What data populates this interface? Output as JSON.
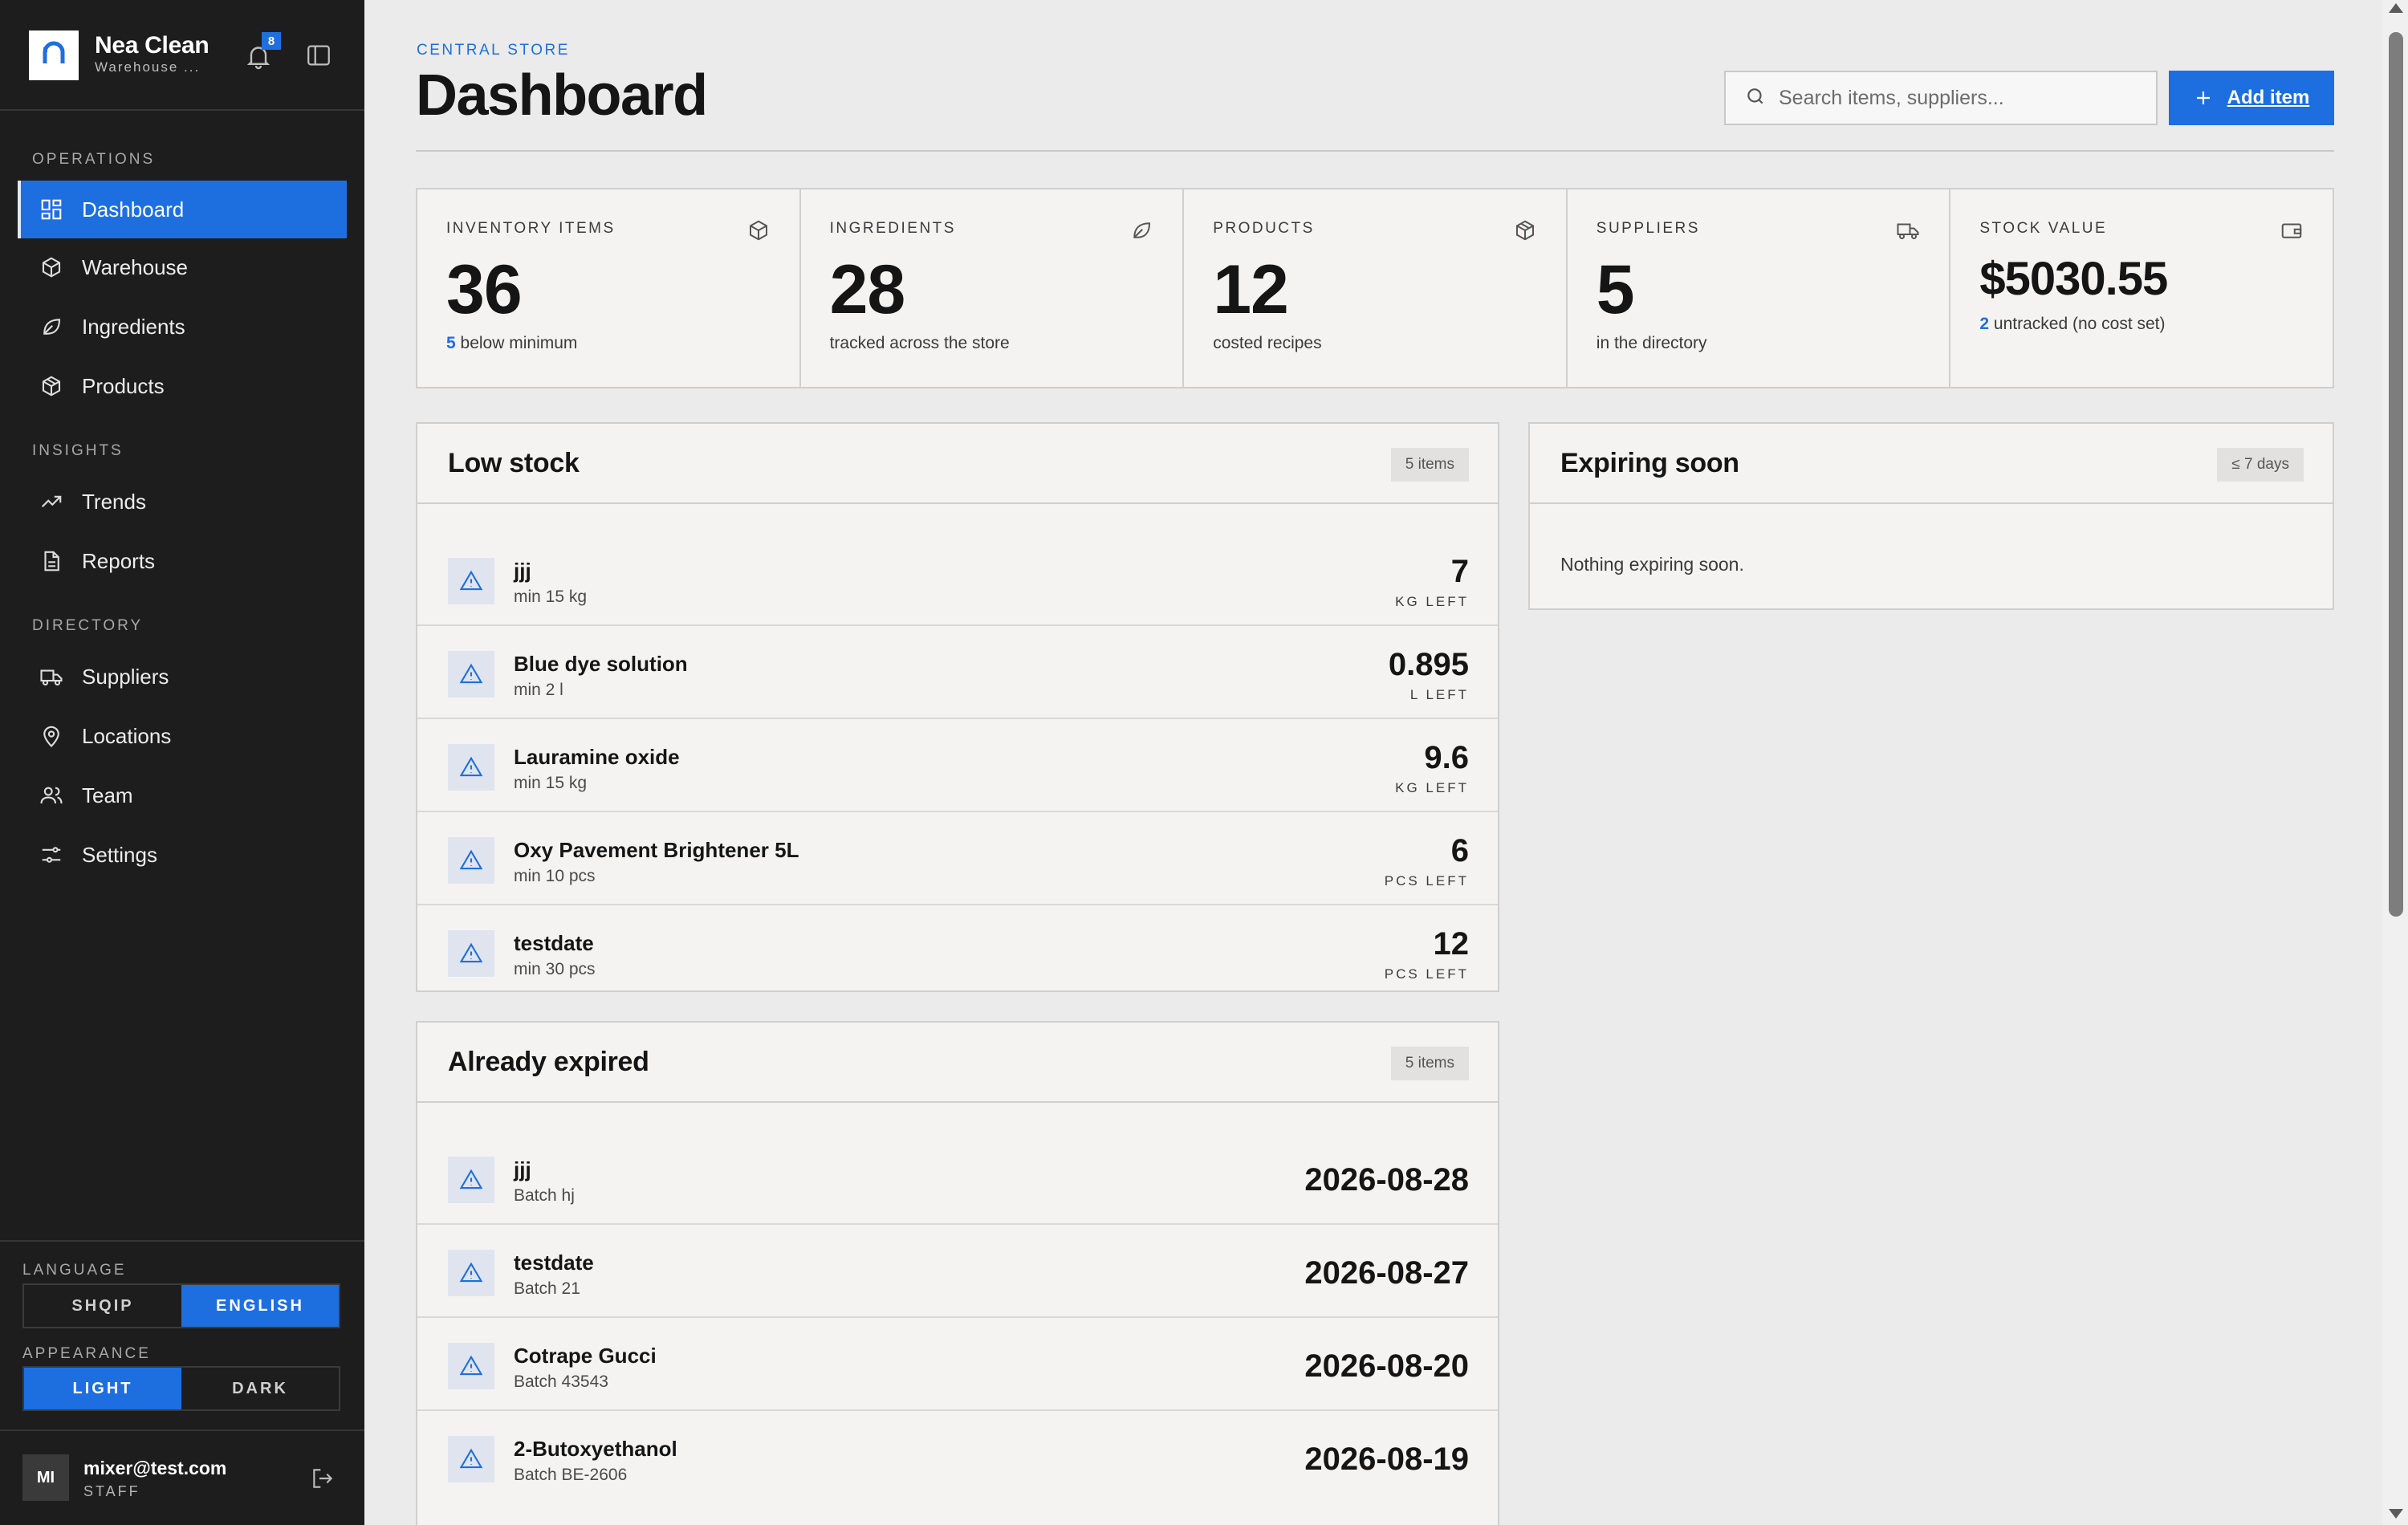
{
  "brand": {
    "name": "Nea Clean",
    "subtitle": "Warehouse ...",
    "notifications": "8"
  },
  "sidebar": {
    "sections": {
      "operations": "OPERATIONS",
      "insights": "INSIGHTS",
      "directory": "DIRECTORY"
    },
    "items": [
      {
        "label": "Dashboard",
        "icon": "grid-icon",
        "active": true
      },
      {
        "label": "Warehouse",
        "icon": "box-icon"
      },
      {
        "label": "Ingredients",
        "icon": "leaf-icon"
      },
      {
        "label": "Products",
        "icon": "package-icon"
      },
      {
        "label": "Trends",
        "icon": "trend-icon"
      },
      {
        "label": "Reports",
        "icon": "file-icon"
      },
      {
        "label": "Suppliers",
        "icon": "truck-icon"
      },
      {
        "label": "Locations",
        "icon": "pin-icon"
      },
      {
        "label": "Team",
        "icon": "users-icon"
      },
      {
        "label": "Settings",
        "icon": "sliders-icon"
      }
    ],
    "language": {
      "label": "LANGUAGE",
      "options": [
        "SHQIP",
        "ENGLISH"
      ],
      "selected": "ENGLISH"
    },
    "appearance": {
      "label": "APPEARANCE",
      "options": [
        "LIGHT",
        "DARK"
      ],
      "selected": "LIGHT"
    },
    "user": {
      "initials": "MI",
      "email": "mixer@test.com",
      "role": "STAFF"
    }
  },
  "header": {
    "breadcrumb": "CENTRAL STORE",
    "title": "Dashboard",
    "search_placeholder": "Search items, suppliers...",
    "add_label": "Add item"
  },
  "stats": [
    {
      "label": "INVENTORY ITEMS",
      "value": "36",
      "highlight": "5",
      "sub": "below minimum",
      "icon": "box-icon"
    },
    {
      "label": "INGREDIENTS",
      "value": "28",
      "sub": "tracked across the store",
      "icon": "leaf-icon"
    },
    {
      "label": "PRODUCTS",
      "value": "12",
      "sub": "costed recipes",
      "icon": "package-icon"
    },
    {
      "label": "SUPPLIERS",
      "value": "5",
      "sub": "in the directory",
      "icon": "truck-icon"
    },
    {
      "label": "STOCK VALUE",
      "value": "$5030.55",
      "highlight": "2",
      "sub": "untracked (no cost set)",
      "icon": "wallet-icon"
    }
  ],
  "low_stock": {
    "title": "Low stock",
    "badge": "5 items",
    "rows": [
      {
        "name": "jjj",
        "sub": "min 15 kg",
        "value": "7",
        "unit": "KG LEFT"
      },
      {
        "name": "Blue dye solution",
        "sub": "min 2 l",
        "value": "0.895",
        "unit": "L LEFT"
      },
      {
        "name": "Lauramine oxide",
        "sub": "min 15 kg",
        "value": "9.6",
        "unit": "KG LEFT"
      },
      {
        "name": "Oxy Pavement Brightener 5L",
        "sub": "min 10 pcs",
        "value": "6",
        "unit": "PCS LEFT"
      },
      {
        "name": "testdate",
        "sub": "min 30 pcs",
        "value": "12",
        "unit": "PCS LEFT"
      }
    ]
  },
  "expiring": {
    "title": "Expiring soon",
    "badge": "≤ 7 days",
    "empty": "Nothing expiring soon."
  },
  "expired": {
    "title": "Already expired",
    "badge": "5 items",
    "rows": [
      {
        "name": "jjj",
        "sub": "Batch hj",
        "date": "2026-08-28"
      },
      {
        "name": "testdate",
        "sub": "Batch 21",
        "date": "2026-08-27"
      },
      {
        "name": "Cotrape Gucci",
        "sub": "Batch 43543",
        "date": "2026-08-20"
      },
      {
        "name": "2-Butoxyethanol",
        "sub": "Batch BE-2606",
        "date": "2026-08-19"
      }
    ]
  },
  "colors": {
    "accent": "#1d6fe0",
    "sidebar": "#1d1d1d",
    "background": "#ebebeb",
    "card": "#f5f3f2"
  }
}
